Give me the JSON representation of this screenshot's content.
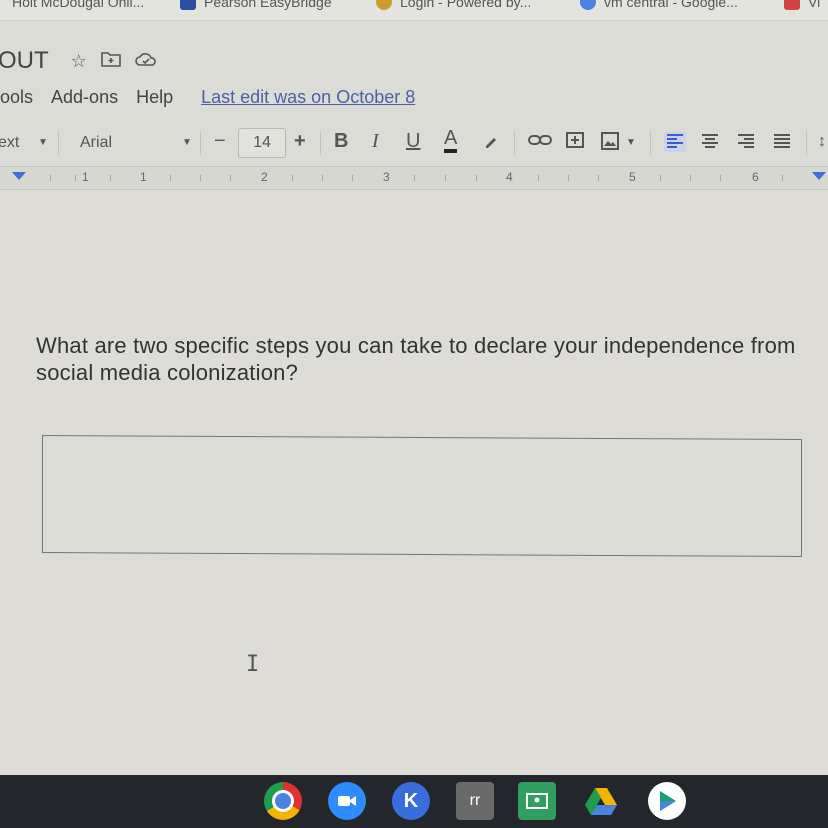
{
  "bookmarks": [
    {
      "label": "Holt McDougal Onli...",
      "color": "#c44"
    },
    {
      "label": "Pearson EasyBridge",
      "color": "#2b4fa0"
    },
    {
      "label": "Login - Powered by...",
      "color": "#c93"
    },
    {
      "label": "vm central - Google...",
      "color": "#4a82e0"
    },
    {
      "label": "Vi",
      "color": "#c44"
    }
  ],
  "doc": {
    "title": "OUT",
    "last_edit": "Last edit was on October 8"
  },
  "menu": [
    "ools",
    "Add-ons",
    "Help"
  ],
  "toolbar": {
    "style": "ext",
    "font": "Arial",
    "font_size": "14",
    "minus": "−",
    "plus": "+",
    "bold": "B",
    "italic": "I",
    "underline": "U",
    "text_color": "A"
  },
  "ruler": [
    "1",
    "1",
    "2",
    "3",
    "4",
    "5",
    "6"
  ],
  "question": "What are two specific steps you can take to declare your independence from social media colonization?",
  "shelf_apps": [
    {
      "name": "chrome",
      "color": "#d9a020"
    },
    {
      "name": "zoom",
      "color": "#2d8cff"
    },
    {
      "name": "kami",
      "color": "#3a6ddc",
      "label": "K"
    },
    {
      "name": "classroom",
      "color": "#6a6a6a",
      "label": "rr"
    },
    {
      "name": "google-classroom",
      "color": "#2f9e5e"
    },
    {
      "name": "drive",
      "color": "#f2b400"
    },
    {
      "name": "play-store",
      "color": "#1a9e6a"
    }
  ]
}
